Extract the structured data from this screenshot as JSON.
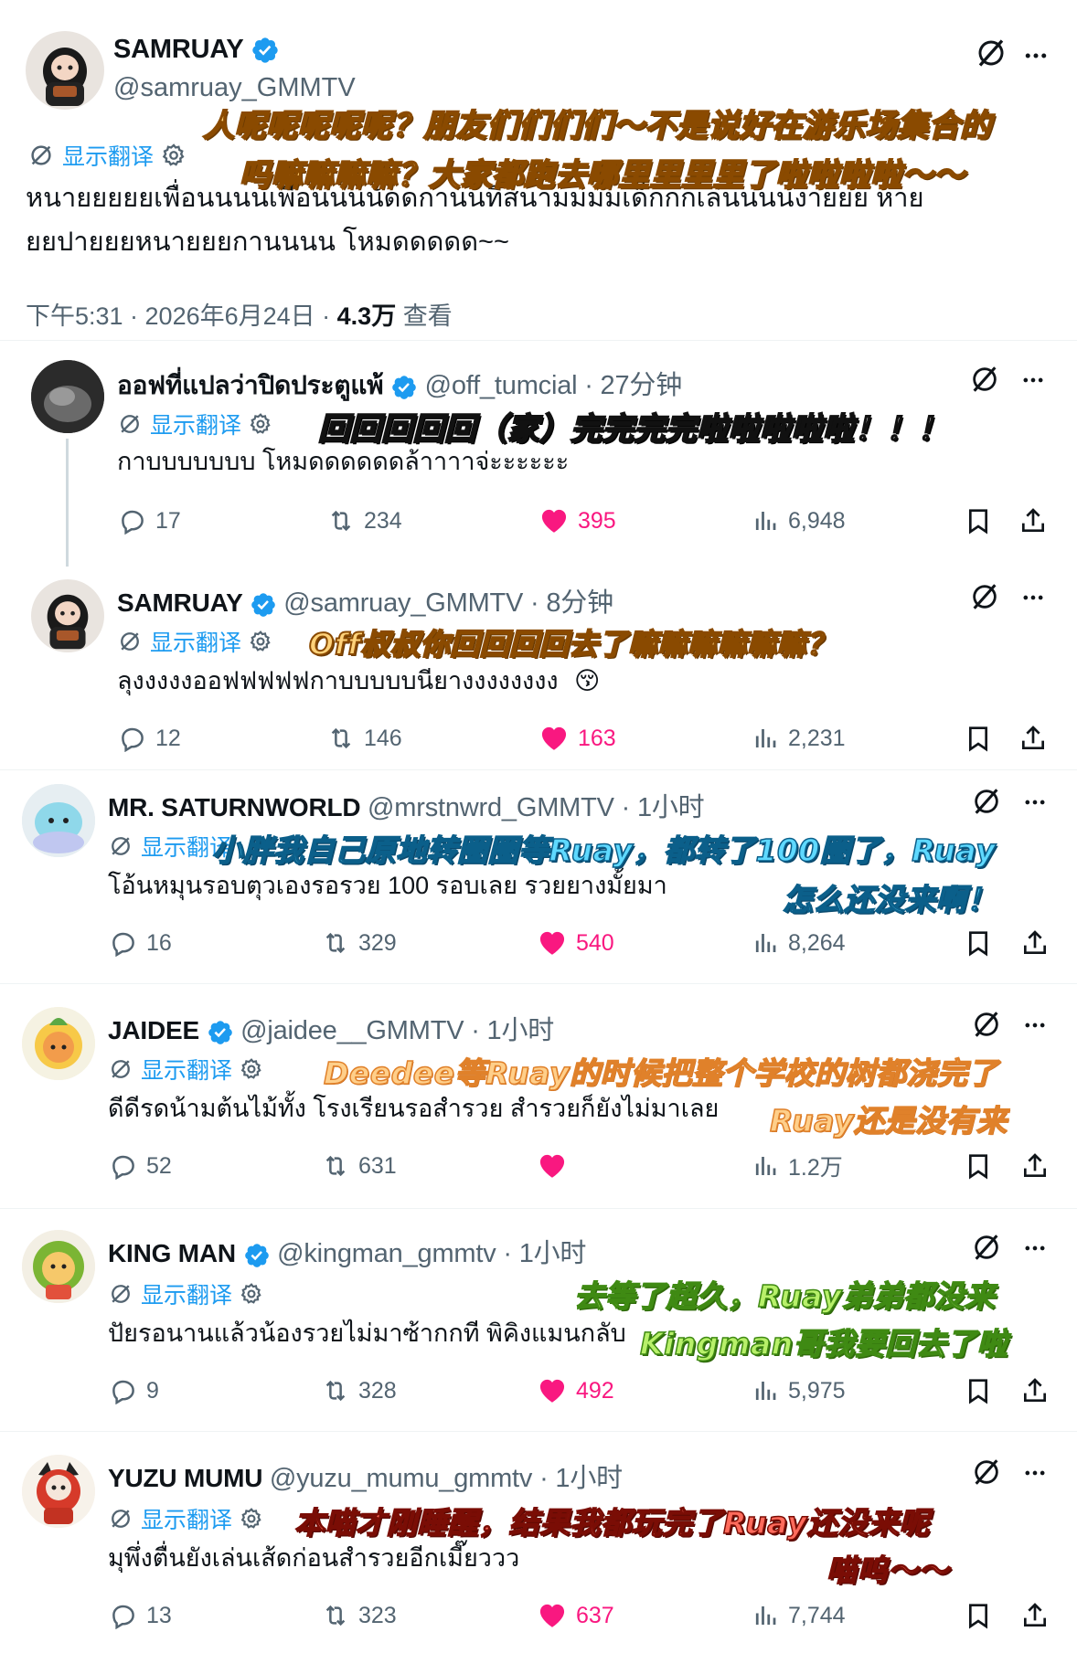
{
  "main_tweet": {
    "name": "SAMRUAY",
    "handle": "@samruay_GMMTV",
    "translate_label": "显示翻译",
    "text_line1": "หนายยยยยเพื่อนนนนเพื่อนนนนัดดกานนทีสนามมมมเด็กกกเล่นนนนงายยย หาย",
    "text_line2": "ยยปายยยหนายยยกานนนน โหมดดดดด~~",
    "meta_time": "下午5:31 · 2026年6月24日 · ",
    "meta_views": "4.3万",
    "meta_views_label": " 查看",
    "overlay_line1": "人呢呢呢呢呢？朋友们们们们～不是说好在游乐场集合的",
    "overlay_line2": "吗嘛嘛嘛嘛？大家都跑去哪里里里里了啦啦啦啦～～"
  },
  "replies": [
    {
      "name": "ออฟที่แปลว่าปิดประตูแพ้",
      "handle": "@off_tumcial · 27分钟",
      "translate_label": "显示翻译",
      "text": "กาบบบบบบบ โหมดดดดดดล้าาาาจ่ะะะะะะ",
      "overlay": [
        "回回回回回（家）完完完完啦啦啦啦啦！！！"
      ],
      "replies": "17",
      "retweets": "234",
      "likes": "395",
      "views": "6,948"
    },
    {
      "name": "SAMRUAY",
      "handle": "@samruay_GMMTV · 8分钟",
      "translate_label": "显示翻译",
      "text": "ลุงงงงงออฟฟฟฟฟกาบบบบบนียางงงงงงงง",
      "emoji": "😚",
      "overlay": [
        "Off叔叔你回回回回去了嘛嘛嘛嘛嘛嘛？"
      ],
      "replies": "12",
      "retweets": "146",
      "likes": "163",
      "views": "2,231"
    },
    {
      "name": "MR. SATURNWORLD",
      "handle": "@mrstnwrd_GMMTV · 1小时",
      "translate_label": "显示翻译",
      "text": "โอ้นหมุนรอบตุวเองรอรวย 100 รอบเลย รวยยางมั้ยมา",
      "overlay": [
        "小胖我自己原地转圈圈等Ruay，都转了100圈了，Ruay",
        "怎么还没来啊！"
      ],
      "replies": "16",
      "retweets": "329",
      "likes": "540",
      "views": "8,264"
    },
    {
      "name": "JAIDEE",
      "handle": "@jaidee__GMMTV · 1小时",
      "translate_label": "显示翻译",
      "text": "ดีดีรดน้ามต้นไม้ทั้ง โรงเรียนรอสำรวย สำรวยก็ยังไม่มาเลย",
      "overlay": [
        "Deedee等Ruay的时候把整个学校的树都浇完了",
        "Ruay还是没有来"
      ],
      "replies": "52",
      "retweets": "631",
      "likes": "",
      "views": "1.2万"
    },
    {
      "name": "KING MAN",
      "handle": "@kingman_gmmtv · 1小时",
      "translate_label": "显示翻译",
      "text": "ปัยรอนานแล้วน้องรวยไม่มาซ้ากกที พิคิงแมนกลับ",
      "overlay": [
        "去等了超久，Ruay弟弟都没来",
        "Kingman哥我要回去了啦"
      ],
      "replies": "9",
      "retweets": "328",
      "likes": "492",
      "views": "5,975"
    },
    {
      "name": "YUZU MUMU",
      "handle": "@yuzu_mumu_gmmtv · 1小时",
      "translate_label": "显示翻译",
      "text": "มุพึ่งตื่นยังเล่นเส้ดก่อนสำรวยอีกเมี๊ยววว",
      "overlay": [
        "本喵才刚睡醒，结果我都玩完了Ruay还没来呢",
        "喵呜～～"
      ],
      "replies": "13",
      "retweets": "323",
      "likes": "637",
      "views": "7,744"
    }
  ],
  "colors": {
    "accent": "#1d9bf0",
    "like": "#f91880",
    "muted": "#536471"
  }
}
